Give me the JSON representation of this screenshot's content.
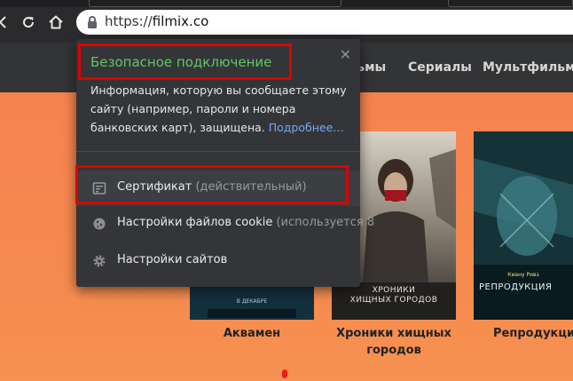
{
  "browser": {
    "url_scheme": "https://",
    "url_host": "filmix.co",
    "icons": [
      "back-icon",
      "reload-icon",
      "home-icon",
      "lock-icon"
    ]
  },
  "site_nav": {
    "items": [
      {
        "label": "льмы"
      },
      {
        "label": "Сериалы"
      },
      {
        "label": "Мультфильмы"
      }
    ]
  },
  "posters": [
    {
      "title": "Аквамен",
      "caption_art": "В ДЕКАБРЕ"
    },
    {
      "title": "Хроники хищных",
      "title2": "городов",
      "caption_art": "ХРОНИКИ\nХИЩНЫХ ГОРОДОВ"
    },
    {
      "title": "Репродукция",
      "caption_art": "РЕПРОДУКЦИЯ",
      "actor_art": "Киану Ривз"
    }
  ],
  "popup": {
    "title": "Безопасное подключение",
    "text": "Информация, которую вы сообщаете этому сайту (например, пароли и номера банковских карт), защищена.",
    "more_link": "Подробнее…",
    "close": "✕",
    "rows": [
      {
        "label": "Сертификат",
        "sub": "(действительный)",
        "icon": "certificate-icon"
      },
      {
        "label": "Настройки файлов cookie",
        "sub": "(используется 8",
        "icon": "cookie-icon"
      },
      {
        "label": "Настройки сайтов",
        "sub": "",
        "icon": "gear-icon"
      }
    ]
  },
  "colors": {
    "secure_green": "#67c46a",
    "highlight_red": "#e00000",
    "link_blue": "#7ba8f2",
    "page_orange": "#f6824f"
  }
}
